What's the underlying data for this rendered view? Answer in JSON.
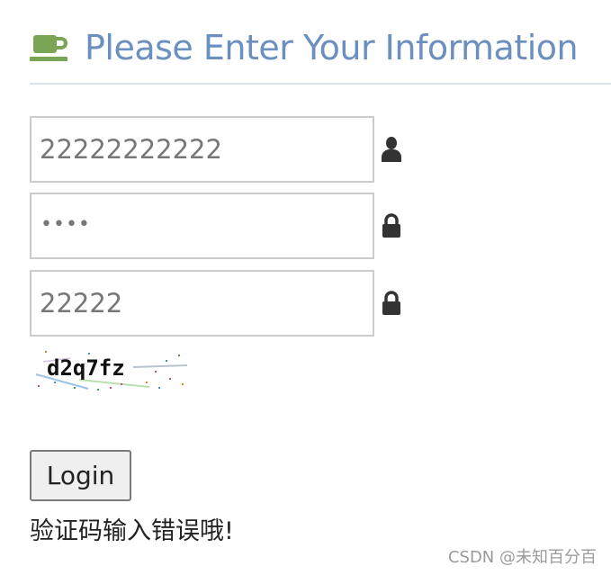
{
  "header": {
    "title": "Please Enter Your Information",
    "icon": "coffee-icon"
  },
  "form": {
    "username": {
      "value": "22222222222",
      "icon": "user-icon"
    },
    "password": {
      "masked_value": "••••",
      "icon": "lock-icon"
    },
    "captcha_input": {
      "value": "22222",
      "icon": "lock-icon"
    },
    "captcha_image_text": "d2q7fz"
  },
  "login_label": "Login",
  "error_message": "验证码输入错误哦!",
  "watermark": "CSDN @未知百分百",
  "colors": {
    "title": "#6b8fbe",
    "coffee_icon": "#7aa554",
    "divider": "#dbe3ea",
    "field_border": "#cccccc",
    "field_text": "#777777",
    "side_icons": "#333333"
  }
}
